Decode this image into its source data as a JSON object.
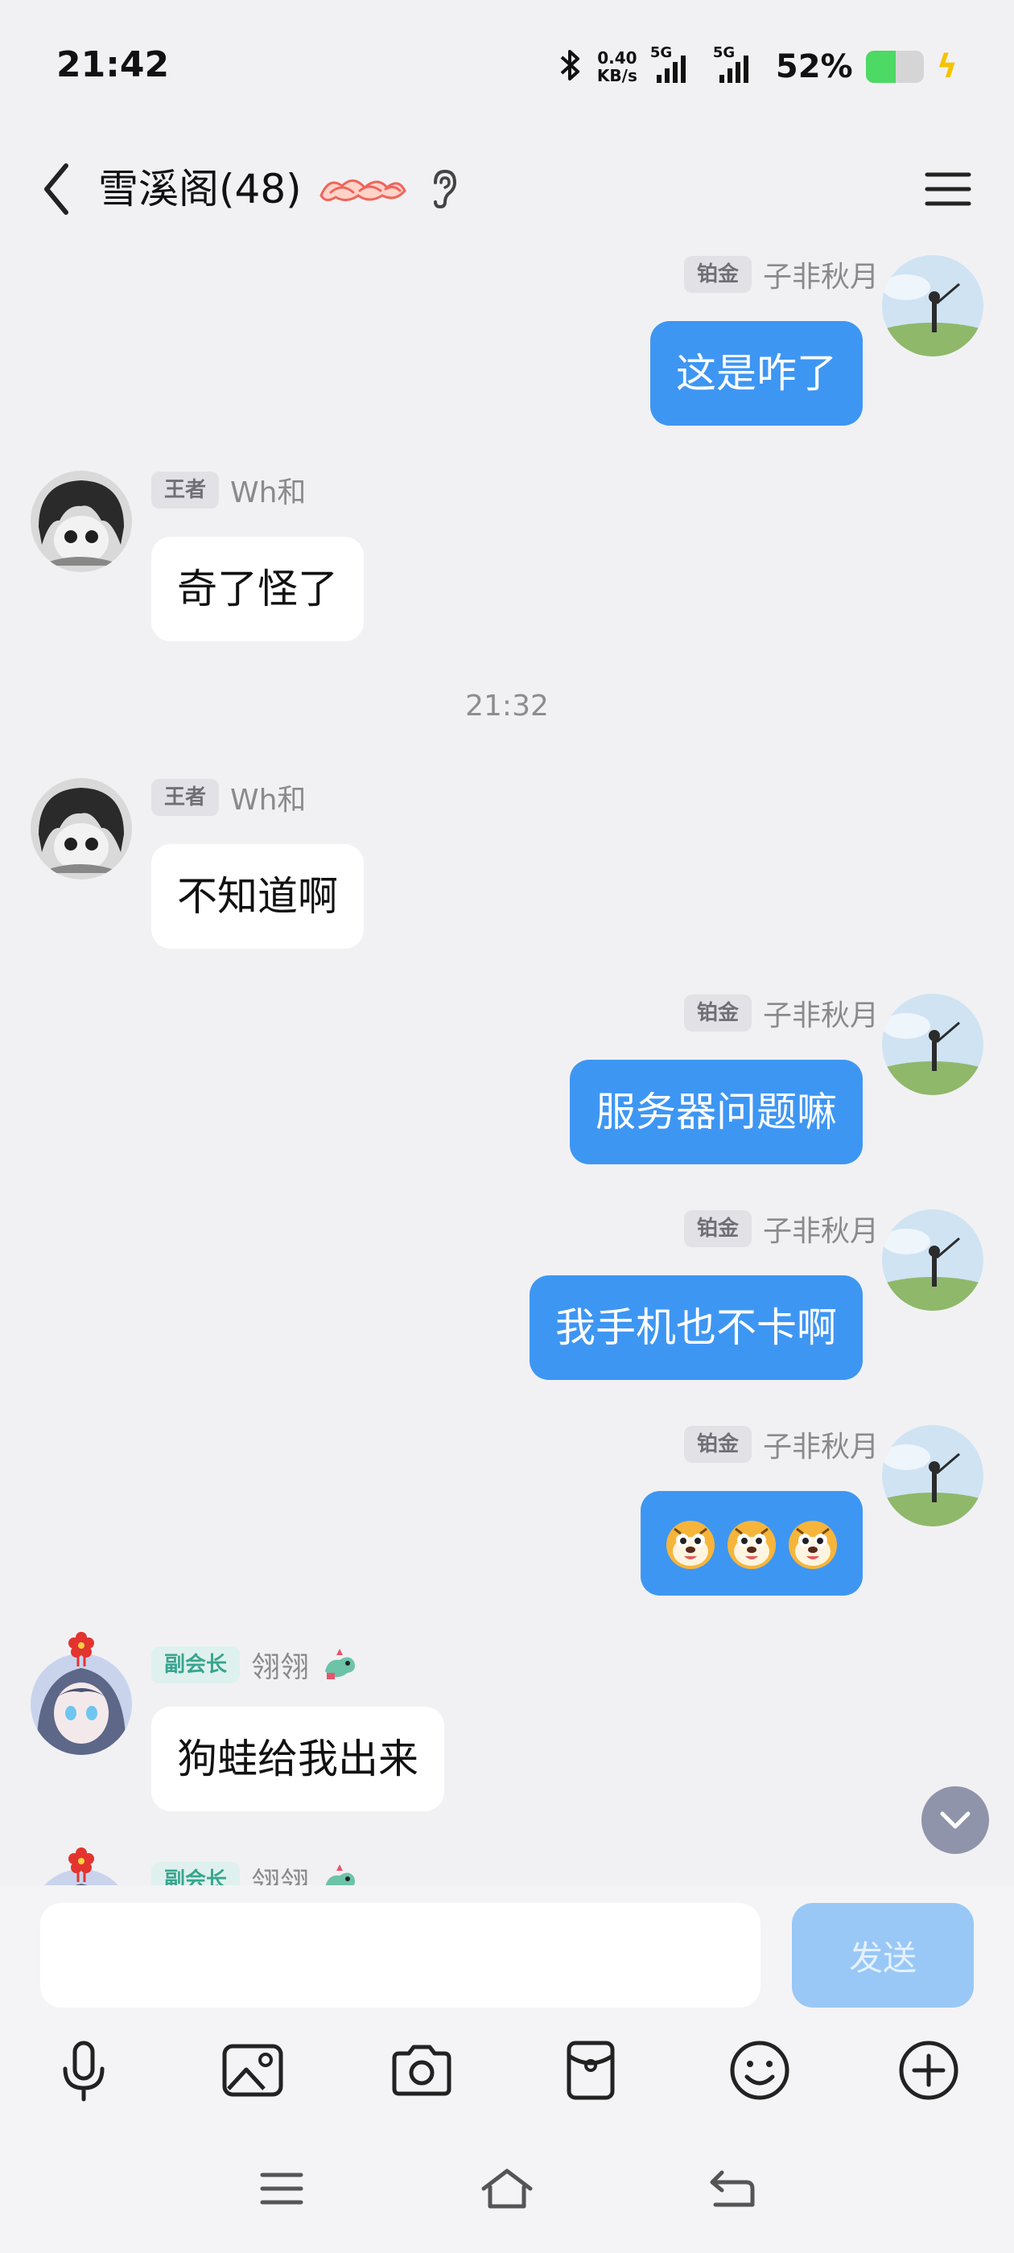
{
  "status_bar": {
    "time": "21:42",
    "net_speed_value": "0.40",
    "net_speed_unit": "KB/s",
    "signal_1_label": "5G",
    "signal_2_label": "5G",
    "battery_percent": "52%",
    "battery_level": 0.52,
    "battery_color": "#4cd964"
  },
  "header": {
    "title": "雪溪阁(48)",
    "badge_icon": "decorative-badge-icon",
    "ear_icon": "ear-icon",
    "menu_icon": "menu-icon"
  },
  "messages": {
    "m1": {
      "direction": "outgoing",
      "role": "铂金",
      "sender": "子非秋月",
      "text": "这是咋了"
    },
    "m2": {
      "direction": "incoming",
      "role": "王者",
      "sender": "Wh和",
      "text": "奇了怪了"
    },
    "time_sep": "21:32",
    "m3": {
      "direction": "incoming",
      "role": "王者",
      "sender": "Wh和",
      "text": "不知道啊"
    },
    "m4": {
      "direction": "outgoing",
      "role": "铂金",
      "sender": "子非秋月",
      "text": "服务器问题嘛"
    },
    "m5": {
      "direction": "outgoing",
      "role": "铂金",
      "sender": "子非秋月",
      "text": "我手机也不卡啊"
    },
    "m6": {
      "direction": "outgoing",
      "role": "铂金",
      "sender": "子非秋月",
      "content_icon": "tiger-face-emoji",
      "emoji_count": 3
    },
    "m7": {
      "direction": "incoming",
      "role": "副会长",
      "sender": "翎翎",
      "text": "狗蛙给我出来"
    },
    "m8": {
      "direction": "incoming",
      "role": "副会长",
      "sender": "翎翎"
    }
  },
  "composer": {
    "input_value": "",
    "send_label": "发送"
  },
  "toolbar": [
    "microphone-icon",
    "image-icon",
    "camera-icon",
    "red-packet-icon",
    "smiley-icon",
    "plus-icon"
  ],
  "nav": [
    "recent-apps-icon",
    "home-icon",
    "back-nav-icon"
  ],
  "colors": {
    "outgoing_bubble": "#3e96f3",
    "incoming_bubble": "#ffffff",
    "background": "#f1f1f3",
    "vice_badge_text": "#38a58f"
  }
}
